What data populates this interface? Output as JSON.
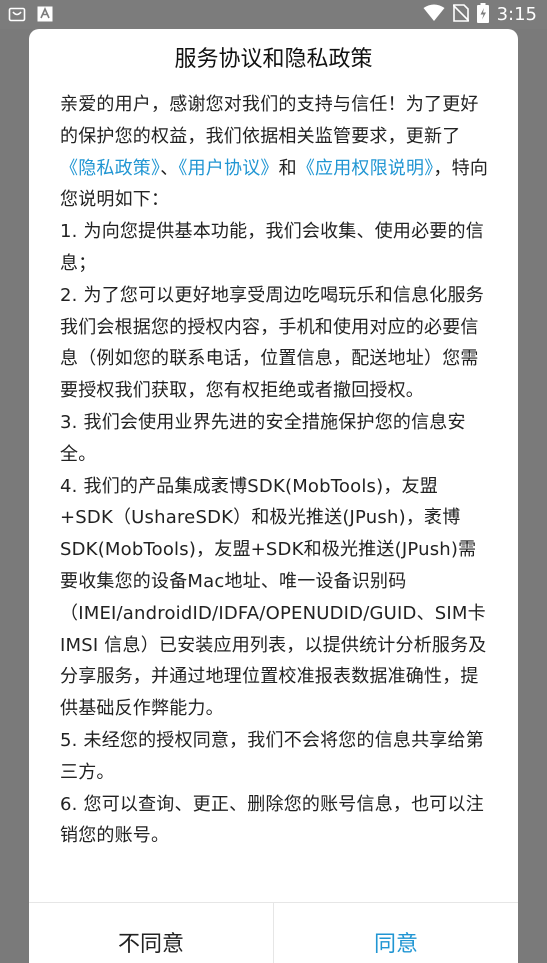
{
  "status_bar": {
    "time": "3:15",
    "left_icons": [
      "shopping-bag-icon",
      "app-a-icon"
    ],
    "right_icons": [
      "wifi-icon",
      "no-sim-icon",
      "battery-icon"
    ]
  },
  "dialog": {
    "title": "服务协议和隐私政策",
    "intro": {
      "text1": "亲爱的用户，感谢您对我们的支持与信任！为了更好的保护您的权益，我们依据相关监管要求，更新了",
      "link_privacy": "《隐私政策》",
      "sep1": "、",
      "link_user_agreement": "《用户协议》",
      "sep2": "和",
      "link_permissions": "《应用权限说明》",
      "text2": "，特向您说明如下："
    },
    "items": [
      " 1. 为向您提供基本功能，我们会收集、使用必要的信息；",
      " 2. 为了您可以更好地享受周边吃喝玩乐和信息化服务我们会根据您的授权内容，手机和使用对应的必要信息（例如您的联系电话，位置信息，配送地址）您需要授权我们获取，您有权拒绝或者撤回授权。",
      " 3. 我们会使用业界先进的安全措施保护您的信息安全。",
      " 4. 我们的产品集成袤博SDK(MobTools)，友盟+SDK（UshareSDK）和极光推送(JPush)，袤博SDK(MobTools)，友盟+SDK和极光推送(JPush)需要收集您的设备Mac地址、唯一设备识别码（IMEI/androidID/IDFA/OPENUDID/GUID、SIM卡 IMSI 信息）已安装应用列表，以提供统计分析服务及分享服务，并通过地理位置校准报表数据准确性，提供基础反作弊能力。",
      " 5. 未经您的授权同意，我们不会将您的信息共享给第三方。",
      " 6. 您可以查询、更正、删除您的账号信息，也可以注销您的账号。"
    ],
    "disagree_label": "不同意",
    "agree_label": "同意"
  },
  "colors": {
    "accent": "#2196d3",
    "overlay": "#7a7a7a",
    "text": "#222222"
  }
}
